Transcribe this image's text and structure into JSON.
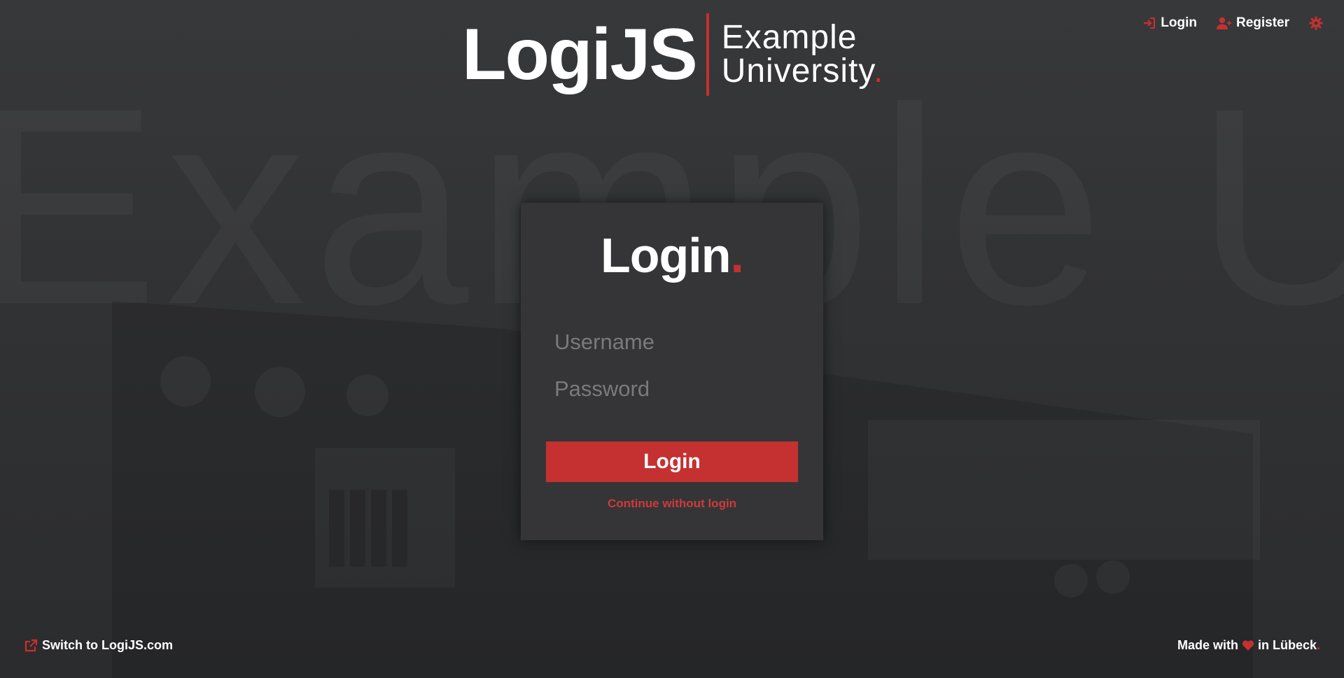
{
  "header": {
    "logo_text": "LogiJS",
    "university_line1": "Example",
    "university_line2": "University",
    "university_dot": "."
  },
  "topnav": {
    "login_label": "Login",
    "register_label": "Register",
    "login_icon": "sign-in-icon",
    "register_icon": "user-plus-icon",
    "settings_icon": "gear-icon"
  },
  "background": {
    "watermark": "Example Un"
  },
  "login_card": {
    "title": "Login",
    "title_dot": ".",
    "username_placeholder": "Username",
    "password_placeholder": "Password",
    "submit_label": "Login",
    "guest_link": "Continue without login"
  },
  "footer": {
    "switch_label": "Switch to LogiJS.com",
    "switch_icon": "external-link-icon",
    "made_with": "Made with",
    "heart_icon": "heart-icon",
    "in_city": "in Lübeck",
    "city_dot": "."
  },
  "colors": {
    "accent": "#c53030",
    "background": "#313234",
    "card": "#353537"
  }
}
